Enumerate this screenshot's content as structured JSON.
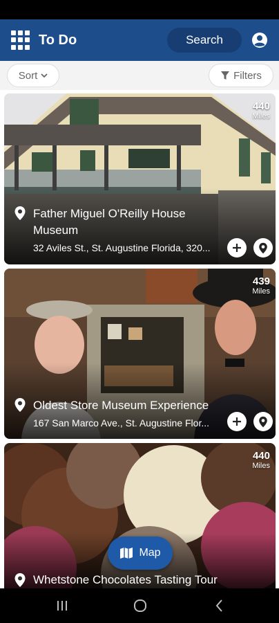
{
  "app_bar": {
    "title": "To Do",
    "search_label": "Search",
    "menu_icon": "grid-menu-icon",
    "account_icon": "account-circle-icon",
    "color": "#1e4d8c"
  },
  "filters": {
    "sort_label": "Sort",
    "filters_label": "Filters"
  },
  "cards": [
    {
      "title": "Father Miguel O'Reilly House Museum",
      "address": "32 Aviles St., St. Augustine Florida, 320...",
      "distance": "440",
      "distance_unit": "Miles"
    },
    {
      "title": "Oldest Store Museum Experience",
      "address": "167 San Marco Ave., St. Augustine Flor...",
      "distance": "439",
      "distance_unit": "Miles"
    },
    {
      "title": "Whetstone Chocolates Tasting Tour",
      "address": "",
      "distance": "440",
      "distance_unit": "Miles"
    }
  ],
  "map_button": {
    "label": "Map",
    "icon": "map-icon"
  },
  "nav": {
    "recents_icon": "recent-apps-icon",
    "home_icon": "home-icon",
    "back_icon": "back-icon"
  }
}
